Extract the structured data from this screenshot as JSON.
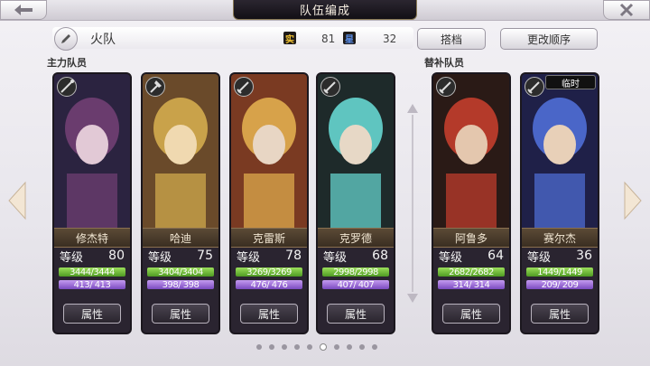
{
  "header": {
    "title": "队伍编成"
  },
  "team": {
    "name": "火队",
    "stat_a_icon": "实",
    "stat_a_value": "81",
    "stat_b_icon": "星",
    "stat_b_value": "32"
  },
  "buttons": {
    "partner": "搭档",
    "change_order": "更改顺序"
  },
  "sections": {
    "main_members": "主力队员",
    "reserve_members": "替补队员"
  },
  "labels": {
    "level": "等级",
    "attribute": "属性",
    "temporary": "临时"
  },
  "members": [
    {
      "name": "修杰特",
      "level": "80",
      "hp": "3444/3444",
      "mp": "413/ 413",
      "class_icon": "staff-icon",
      "palette": [
        "#2b2340",
        "#6a3c6e",
        "#e2c9d6"
      ]
    },
    {
      "name": "哈迪",
      "level": "75",
      "hp": "3404/3404",
      "mp": "398/ 398",
      "class_icon": "axe-icon",
      "palette": [
        "#6a4a2a",
        "#c9a24a",
        "#f0d9b0"
      ]
    },
    {
      "name": "克雷斯",
      "level": "78",
      "hp": "3269/3269",
      "mp": "476/ 476",
      "class_icon": "sword-icon",
      "palette": [
        "#7a3a22",
        "#d7a24a",
        "#e8d6c4"
      ]
    },
    {
      "name": "克罗德",
      "level": "68",
      "hp": "2998/2998",
      "mp": "407/ 407",
      "class_icon": "sword-icon",
      "palette": [
        "#1e2a2a",
        "#5fc5c0",
        "#e7d8c6"
      ]
    }
  ],
  "reserves": [
    {
      "name": "阿鲁多",
      "level": "64",
      "hp": "2682/2682",
      "mp": "314/ 314",
      "class_icon": "sword-icon",
      "palette": [
        "#2a1a16",
        "#b43a2a",
        "#e4c7ae"
      ],
      "temporary": false
    },
    {
      "name": "赛尔杰",
      "level": "36",
      "hp": "1449/1449",
      "mp": "209/ 209",
      "class_icon": "sword-icon",
      "palette": [
        "#1f2048",
        "#4a66c8",
        "#e8d0b8"
      ],
      "temporary": true
    }
  ],
  "pagination": {
    "count": 10,
    "active_index": 5
  },
  "colors": {
    "hp_bar": "#6fbf34",
    "mp_bar": "#9a68d8",
    "title_plate": "#1c181f"
  }
}
